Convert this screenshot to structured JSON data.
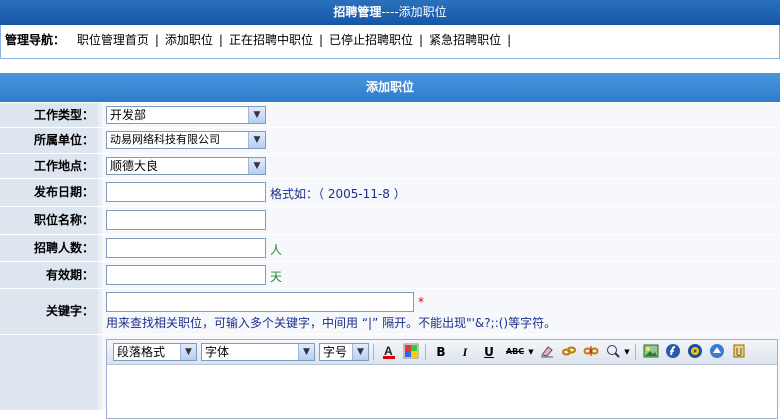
{
  "header": {
    "title": "招聘管理",
    "separator": "----",
    "subtitle": "添加职位"
  },
  "nav": {
    "label": "管理导航：",
    "items": [
      {
        "label": "职位管理首页"
      },
      {
        "label": "添加职位"
      },
      {
        "label": "正在招聘中职位"
      },
      {
        "label": "已停止招聘职位"
      },
      {
        "label": "紧急招聘职位"
      }
    ],
    "separator": "|"
  },
  "section": {
    "title": "添加职位"
  },
  "form": {
    "job_type": {
      "label": "工作类型：",
      "value": "开发部"
    },
    "unit": {
      "label": "所属单位：",
      "value": "动易网络科技有限公司"
    },
    "location": {
      "label": "工作地点：",
      "value": "顺德大良"
    },
    "publish_date": {
      "label": "发布日期：",
      "value": "",
      "hint": "格式如：（ 2005-11-8 ）"
    },
    "position_name": {
      "label": "职位名称：",
      "value": ""
    },
    "headcount": {
      "label": "招聘人数：",
      "value": "",
      "unit": "人"
    },
    "validity": {
      "label": "有效期：",
      "value": "",
      "unit": "天"
    },
    "keywords": {
      "label": "关键字：",
      "value": "",
      "required_mark": "*",
      "hint": "用来查找相关职位，可输入多个关键字，中间用 “|” 隔开。不能出现\"'&?;:()等字符。"
    }
  },
  "editor": {
    "paragraph_format": "段落格式",
    "font": "字体",
    "font_size": "字号",
    "buttons": {
      "bold": "B",
      "italic": "I",
      "underline": "U",
      "strike": "ABC"
    }
  },
  "colors": {
    "header": "#1656a6",
    "section": "#3a89d4",
    "hint_blue": "#1c2f8c",
    "unit_green": "#2a8a2a",
    "required_red": "#d10000"
  }
}
